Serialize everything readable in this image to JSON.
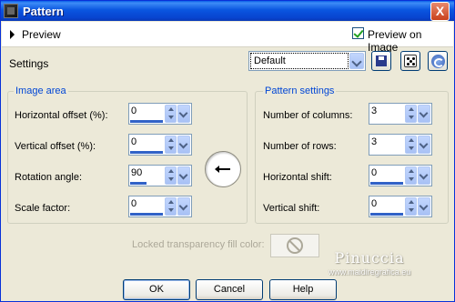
{
  "window": {
    "title": "Pattern",
    "close_glyph": "X"
  },
  "preview": {
    "label": "Preview",
    "preview_on_image_label": "Preview on Image",
    "preview_on_image_checked": true
  },
  "settings": {
    "label": "Settings",
    "selected": "Default"
  },
  "image_area": {
    "title": "Image area",
    "horizontal_offset": {
      "label": "Horizontal offset (%):",
      "value": "0"
    },
    "vertical_offset": {
      "label": "Vertical offset (%):",
      "value": "0"
    },
    "rotation_angle": {
      "label": "Rotation angle:",
      "value": "90"
    },
    "scale_factor": {
      "label": "Scale factor:",
      "value": "0"
    }
  },
  "pattern_settings": {
    "title": "Pattern settings",
    "number_of_columns": {
      "label": "Number of columns:",
      "value": "3"
    },
    "number_of_rows": {
      "label": "Number of rows:",
      "value": "3"
    },
    "horizontal_shift": {
      "label": "Horizontal shift:",
      "value": "0"
    },
    "vertical_shift": {
      "label": "Vertical shift:",
      "value": "0"
    }
  },
  "locked_transparency": {
    "label": "Locked transparency fill color:"
  },
  "watermark": {
    "name": "Pinuccia",
    "url": "www.maidiregrafica.eu"
  },
  "buttons": {
    "ok": "OK",
    "cancel": "Cancel",
    "help": "Help"
  }
}
